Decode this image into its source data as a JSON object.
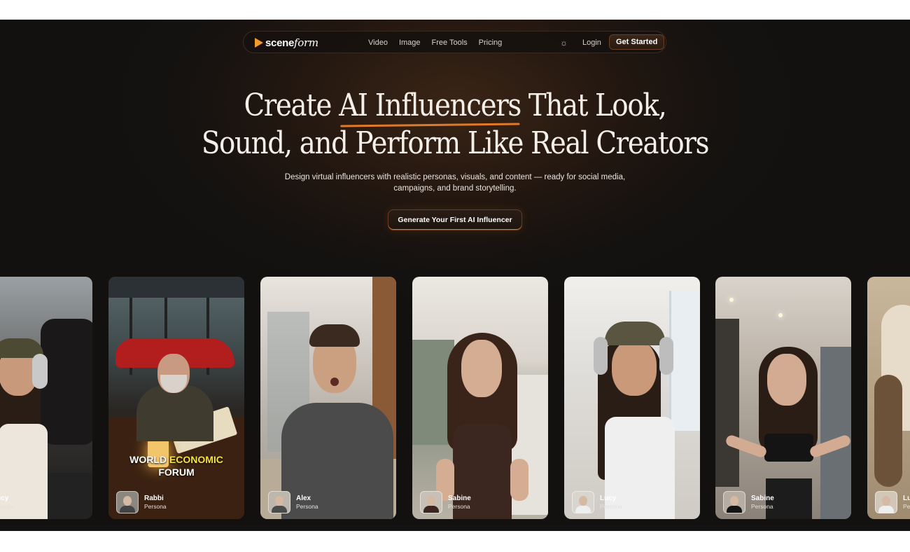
{
  "brand": {
    "name_bold": "scene",
    "name_italic": "form"
  },
  "nav": {
    "links": [
      "Video",
      "Image",
      "Free Tools",
      "Pricing"
    ],
    "theme_icon": "sun-icon",
    "login": "Login",
    "cta": "Get Started"
  },
  "hero": {
    "line1_a": "Create ",
    "line1_highlight": "AI Influencers",
    "line1_b": " That Look,",
    "line2": "Sound, and Perform Like Real Creators",
    "subtitle": "Design virtual influencers with realistic personas, visuals, and content — ready for social media, campaigns, and brand storytelling.",
    "cta": "Generate Your First AI Influencer"
  },
  "cards": [
    {
      "name": "Lucy",
      "role": "Persona",
      "overlay": ""
    },
    {
      "name": "Rabbi",
      "role": "Persona",
      "overlay_l1_a": "WORLD ",
      "overlay_l1_b": "ECONOMIC",
      "overlay_l2": "FORUM"
    },
    {
      "name": "Alex",
      "role": "Persona"
    },
    {
      "name": "Sabine",
      "role": "Persona"
    },
    {
      "name": "Lucy",
      "role": "Persona"
    },
    {
      "name": "Sabine",
      "role": "Persona"
    },
    {
      "name": "Lucy",
      "role": "Persona"
    }
  ],
  "colors": {
    "accent": "#e07a2a",
    "logo": "#f39a2c",
    "background": "#151210"
  }
}
